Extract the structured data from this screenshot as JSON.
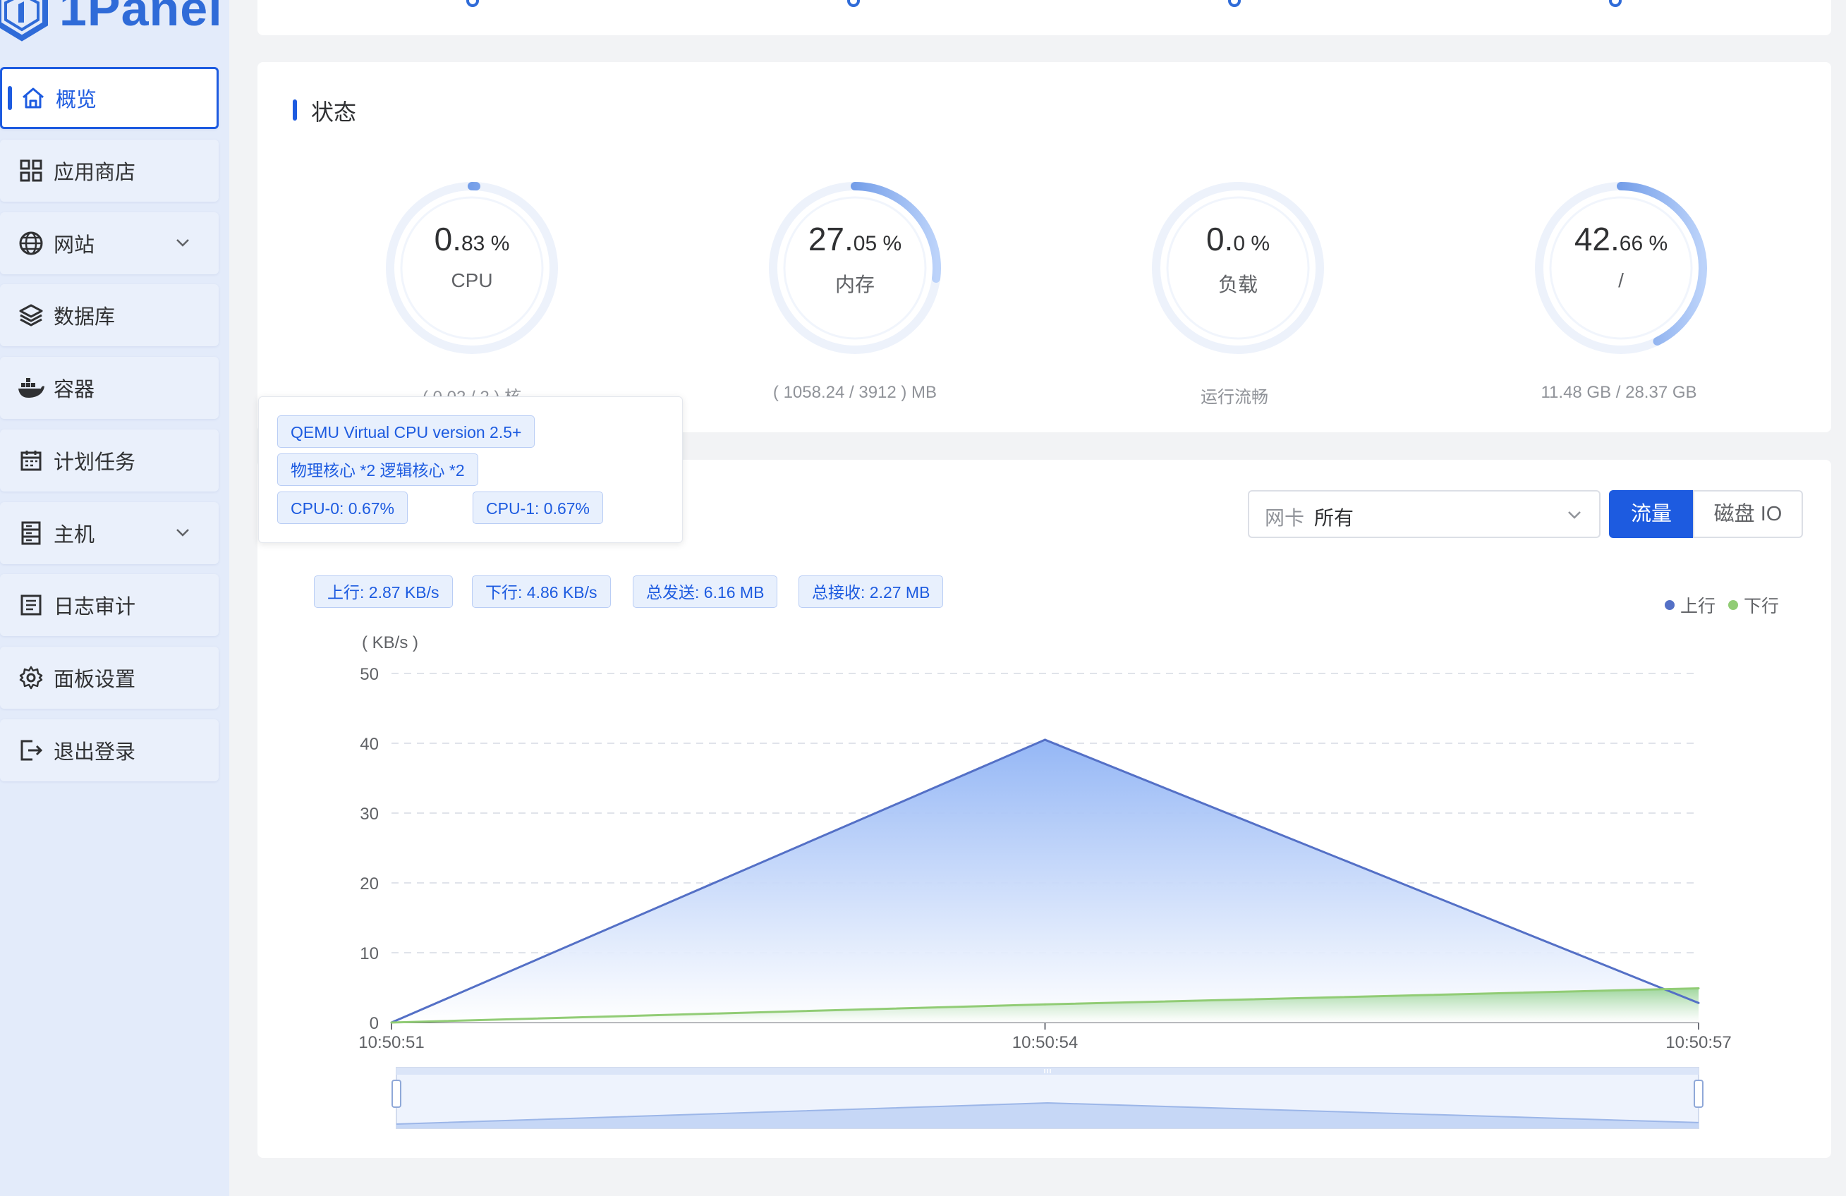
{
  "app": {
    "brand": "1Panel"
  },
  "sidebar": {
    "items": [
      {
        "label": "概览",
        "icon": "home-icon",
        "active": true
      },
      {
        "label": "应用商店",
        "icon": "grid-icon"
      },
      {
        "label": "网站",
        "icon": "globe-icon",
        "expandable": true
      },
      {
        "label": "数据库",
        "icon": "layers-icon"
      },
      {
        "label": "容器",
        "icon": "docker-icon"
      },
      {
        "label": "计划任务",
        "icon": "calendar-icon"
      },
      {
        "label": "主机",
        "icon": "server-icon",
        "expandable": true
      },
      {
        "label": "日志审计",
        "icon": "log-icon"
      },
      {
        "label": "面板设置",
        "icon": "gear-icon"
      },
      {
        "label": "退出登录",
        "icon": "logout-icon"
      }
    ]
  },
  "status": {
    "title": "状态",
    "gauges": [
      {
        "int": "0.",
        "dec": "83 %",
        "label": "CPU",
        "sub": "( 0.02 / 2 ) 核",
        "percent": 0.83
      },
      {
        "int": "27.",
        "dec": "05 %",
        "label": "内存",
        "sub": "( 1058.24 / 3912 ) MB",
        "percent": 27.05
      },
      {
        "int": "0.",
        "dec": "0 %",
        "label": "负载",
        "sub": "运行流畅",
        "percent": 0
      },
      {
        "int": "42.",
        "dec": "66 %",
        "label": "/",
        "sub": "11.48 GB / 28.37 GB",
        "percent": 42.66
      }
    ]
  },
  "tooltip": {
    "cpu_model": "QEMU Virtual CPU version 2.5+",
    "cores": "物理核心 *2 逻辑核心 *2",
    "cpu0": "CPU-0: 0.67%",
    "cpu1": "CPU-1: 0.67%"
  },
  "monitor": {
    "select_prefix": "网卡",
    "select_value": "所有",
    "tab_flow": "流量",
    "tab_disk": "磁盘 IO",
    "stats": {
      "up": "上行: 2.87 KB/s",
      "down": "下行: 4.86 KB/s",
      "sent": "总发送: 6.16 MB",
      "recv": "总接收: 2.27 MB"
    }
  },
  "colors": {
    "accent": "#1d5be0",
    "up_line": "#5470c6",
    "down_line": "#91cc75"
  },
  "chart_data": {
    "type": "area",
    "ylabel": "( KB/s )",
    "x": [
      "10:50:51",
      "10:50:54",
      "10:50:57"
    ],
    "ylim": [
      0,
      50
    ],
    "yticks": [
      0,
      10,
      20,
      30,
      40,
      50
    ],
    "series": [
      {
        "name": "上行",
        "values": [
          0,
          40.5,
          2.8
        ]
      },
      {
        "name": "下行",
        "values": [
          0,
          2.6,
          4.9
        ]
      }
    ],
    "legend": "top-right",
    "grid": true
  }
}
